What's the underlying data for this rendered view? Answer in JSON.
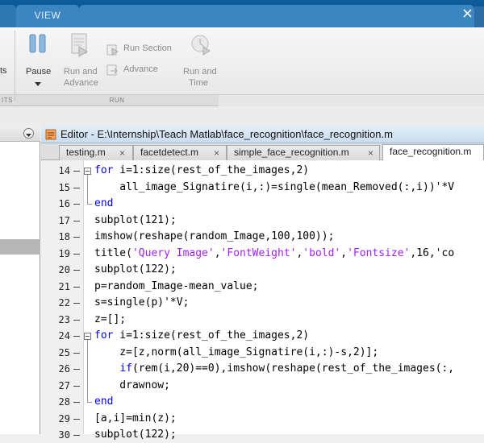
{
  "tabs": {
    "view_label": "VIEW"
  },
  "ribbon": {
    "partial_left_label": "ts",
    "partial_left_section": "ITS",
    "pause_label": "Pause",
    "run_advance_label_1": "Run and",
    "run_advance_label_2": "Advance",
    "run_section_label": "Run Section",
    "advance_label": "Advance",
    "run_time_label_1": "Run and",
    "run_time_label_2": "Time",
    "run_section_title": "RUN"
  },
  "editor": {
    "title": "Editor - E:\\Internship\\Teach Matlab\\face_recognition\\face_recognition.m",
    "files": [
      {
        "name": "testing.m",
        "close": "×"
      },
      {
        "name": "facetdetect.m",
        "close": "×"
      },
      {
        "name": "simple_face_recognition.m",
        "close": "×"
      },
      {
        "name": "face_recognition.m",
        "close": ""
      }
    ],
    "lines": [
      {
        "num": "14",
        "text": "for i=1:size(rest_of_the_images,2)"
      },
      {
        "num": "15",
        "text": "    all_image_Signatire(i,:)=single(mean_Removed(:,i))'*V"
      },
      {
        "num": "16",
        "text": "end"
      },
      {
        "num": "17",
        "text": "subplot(121);"
      },
      {
        "num": "18",
        "text": "imshow(reshape(random_Image,100,100));"
      },
      {
        "num": "19",
        "text": "title('Query Image','FontWeight','bold','Fontsize',16,'co"
      },
      {
        "num": "20",
        "text": "subplot(122);"
      },
      {
        "num": "21",
        "text": "p=random_Image-mean_value;"
      },
      {
        "num": "22",
        "text": "s=single(p)'*V;"
      },
      {
        "num": "23",
        "text": "z=[];"
      },
      {
        "num": "24",
        "text": "for i=1:size(rest_of_the_images,2)"
      },
      {
        "num": "25",
        "text": "    z=[z,norm(all_image_Signatire(i,:)-s,2)];"
      },
      {
        "num": "26",
        "text": "    if(rem(i,20)==0),imshow(reshape(rest_of_the_images(:,"
      },
      {
        "num": "27",
        "text": "    drawnow;"
      },
      {
        "num": "28",
        "text": "end"
      },
      {
        "num": "29",
        "text": "[a,i]=min(z);"
      },
      {
        "num": "30",
        "text": "subplot(122);"
      }
    ]
  },
  "colors": {
    "keyword": "#0000ff",
    "string": "#a020f0",
    "tabstrip": "#0f5c9a"
  },
  "icons": [
    "pause-icon",
    "run-advance-icon",
    "run-section-icon",
    "advance-icon",
    "run-time-icon",
    "close-icon",
    "editor-file-icon",
    "panel-menu-icon",
    "fold-icon"
  ]
}
